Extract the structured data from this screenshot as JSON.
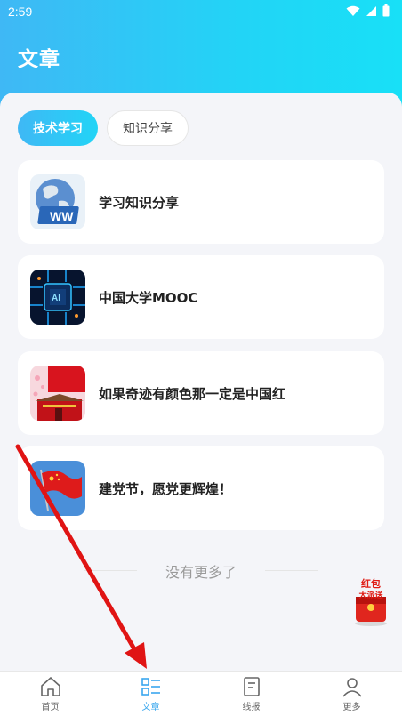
{
  "status": {
    "time": "2:59"
  },
  "header": {
    "title": "文章"
  },
  "tabs": [
    {
      "label": "技术学习",
      "active": true
    },
    {
      "label": "知识分享",
      "active": false
    }
  ],
  "articles": [
    {
      "title": "学习知识分享",
      "thumb_icon": "globe-www-icon"
    },
    {
      "title": "中国大学MOOC",
      "thumb_icon": "ai-chip-icon"
    },
    {
      "title": "如果奇迹有颜色那一定是中国红",
      "thumb_icon": "tiananmen-icon"
    },
    {
      "title": "建党节，愿党更辉煌！",
      "thumb_icon": "red-flag-icon"
    }
  ],
  "list_footer": "没有更多了",
  "red_packet": {
    "line1": "红包",
    "line2": "大派送"
  },
  "bottom_nav": [
    {
      "label": "首页",
      "icon": "home-icon",
      "active": false
    },
    {
      "label": "文章",
      "icon": "list-icon",
      "active": true
    },
    {
      "label": "线报",
      "icon": "document-icon",
      "active": false
    },
    {
      "label": "更多",
      "icon": "user-icon",
      "active": false
    }
  ],
  "colors": {
    "accent": "#3aa7ee",
    "header_gradient_start": "#3fb8f5",
    "header_gradient_end": "#18e0f7"
  }
}
